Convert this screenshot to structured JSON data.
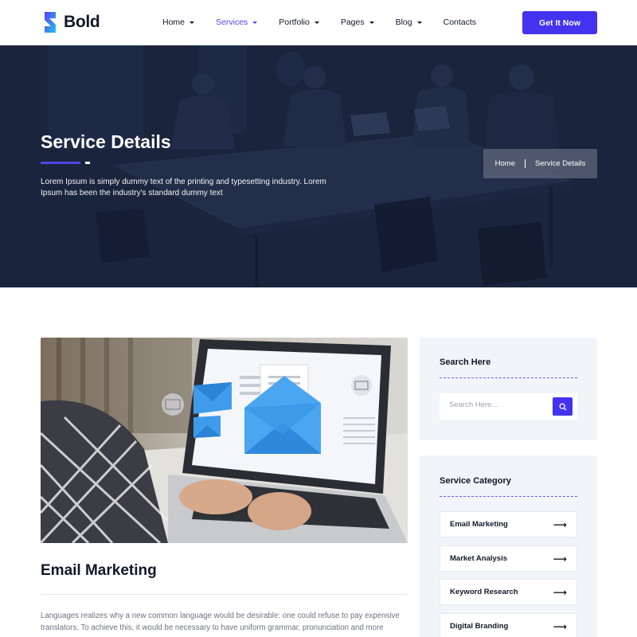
{
  "brand": {
    "name": "Bold"
  },
  "nav": [
    {
      "label": "Home",
      "dropdown": true,
      "active": false
    },
    {
      "label": "Services",
      "dropdown": true,
      "active": true
    },
    {
      "label": "Portfolio",
      "dropdown": true,
      "active": false
    },
    {
      "label": "Pages",
      "dropdown": true,
      "active": false
    },
    {
      "label": "Blog",
      "dropdown": true,
      "active": false
    },
    {
      "label": "Contacts",
      "dropdown": false,
      "active": false
    }
  ],
  "header": {
    "cta_label": "Get It Now"
  },
  "hero": {
    "title": "Service Details",
    "description": "Lorem Ipsum is simply dummy text of the printing and typesetting industry. Lorem Ipsum has been the industry's standard dummy text",
    "breadcrumb": {
      "home": "Home",
      "current": "Service Details"
    }
  },
  "service": {
    "title": "Email Marketing",
    "body": "Languages realizes why a new common language would be desirable: one could refuse to pay expensive translators. To achieve this, it would be necessary to have uniform grammar, pronunciation and more"
  },
  "sidebar": {
    "search": {
      "title": "Search Here",
      "placeholder": "Search Here..."
    },
    "categories": {
      "title": "Service Category",
      "items": [
        {
          "label": "Email Marketing"
        },
        {
          "label": "Market Analysis"
        },
        {
          "label": "Keyword Research"
        },
        {
          "label": "Digital Branding"
        }
      ]
    }
  },
  "colors": {
    "accent": "#4433ee",
    "hero_overlay": "#1a2438",
    "sidebar_bg": "#f1f4f9"
  }
}
